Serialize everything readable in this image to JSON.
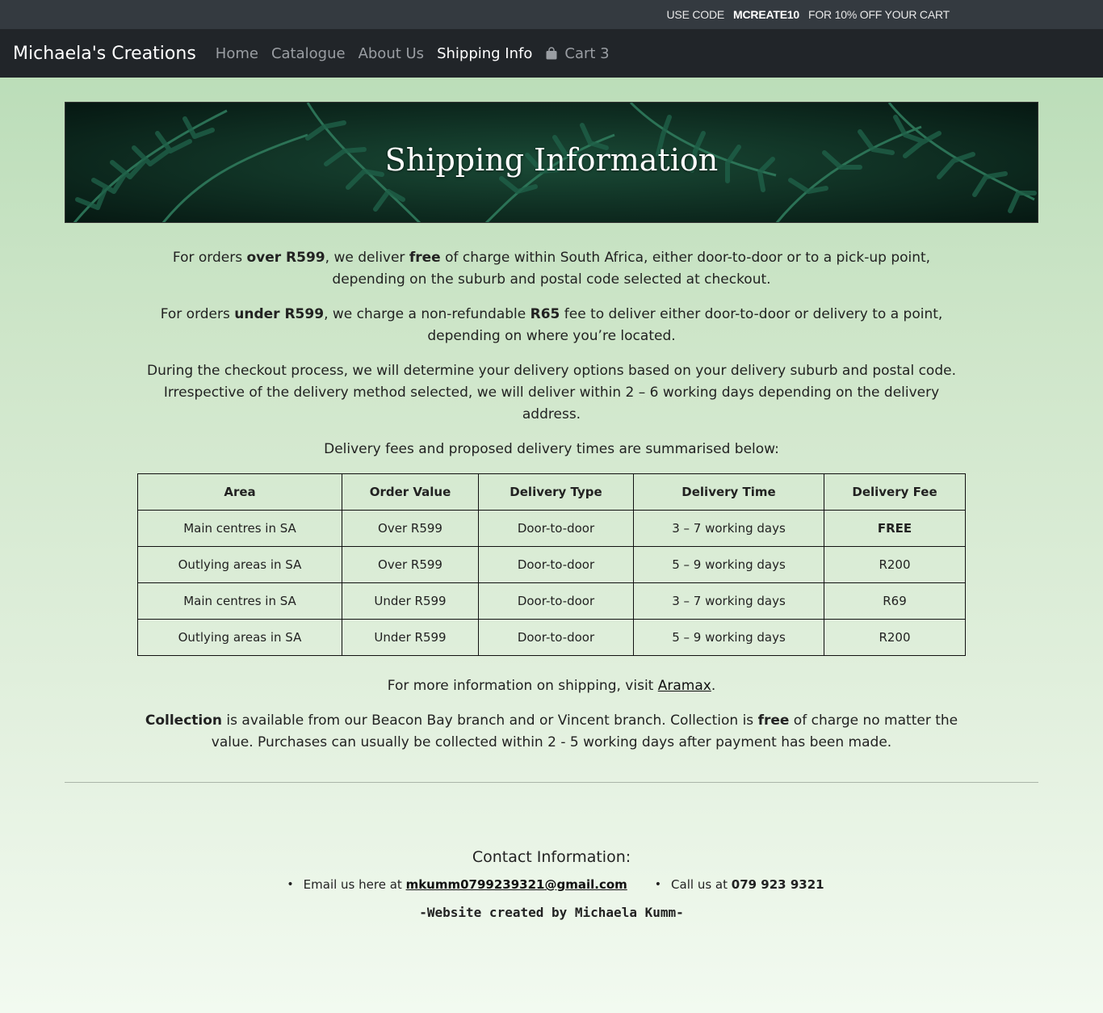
{
  "promo": {
    "prefix": "USE CODE",
    "code": "MCREATE10",
    "suffix": "FOR 10% OFF YOUR CART"
  },
  "nav": {
    "brand": "Michaela's Creations",
    "links": [
      "Home",
      "Catalogue",
      "About Us",
      "Shipping Info"
    ],
    "cart_label": "Cart 3",
    "cart_icon": "shopping-bag-icon"
  },
  "banner": {
    "title": "Shipping Information"
  },
  "intro": {
    "p1": {
      "a": "For orders ",
      "b1": "over R599",
      "c": ", we deliver ",
      "b2": "free",
      "d": " of charge within South Africa, either door-to-door or to a pick-up point, depending on the suburb and postal code selected at checkout."
    },
    "p2": {
      "a": "For orders ",
      "b1": "under R599",
      "c": ", we charge a non-refundable ",
      "b2": "R65",
      "d": " fee to deliver either door-to-door or delivery to a point, depending on where you’re located."
    },
    "p3": "During the checkout process, we will determine your delivery options based on your delivery suburb and postal code. Irrespective of the delivery method selected, we will deliver within 2 – 6 working days depending on the delivery address.",
    "p4": "Delivery fees and proposed delivery times are summarised below:"
  },
  "table": {
    "headers": [
      "Area",
      "Order Value",
      "Delivery Type",
      "Delivery Time",
      "Delivery Fee"
    ],
    "rows": [
      [
        "Main centres in SA",
        "Over R599",
        "Door-to-door",
        "3 – 7 working days",
        "FREE"
      ],
      [
        "Outlying areas in SA",
        "Over R599",
        "Door-to-door",
        "5 – 9 working days",
        "R200"
      ],
      [
        "Main centres in SA",
        "Under R599",
        "Door-to-door",
        "3 – 7 working days",
        "R69"
      ],
      [
        "Outlying areas in SA",
        "Under R599",
        "Door-to-door",
        "5 – 9 working days",
        "R200"
      ]
    ]
  },
  "more_info": {
    "text": "For more information on shipping, visit ",
    "link": "Aramax",
    "end": "."
  },
  "collection": {
    "b1": "Collection",
    "a": " is available from our Beacon Bay branch and or Vincent branch. Collection is ",
    "b2": "free",
    "c": " of charge no matter the value. Purchases can usually be collected within 2 - 5 working days after payment has been made."
  },
  "contact": {
    "heading": "Contact Information:",
    "email_prefix": "Email us here at ",
    "email": "mkumm0799239321@gmail.com",
    "phone_prefix": "Call us at ",
    "phone": "079 923 9321",
    "credit": "-Website created by Michaela Kumm-"
  },
  "colors": {
    "promo_bg": "#343a40",
    "navbar_bg": "#212529",
    "page_gradient_top": "#b6dbb4",
    "page_gradient_bottom": "#f2faf0"
  }
}
